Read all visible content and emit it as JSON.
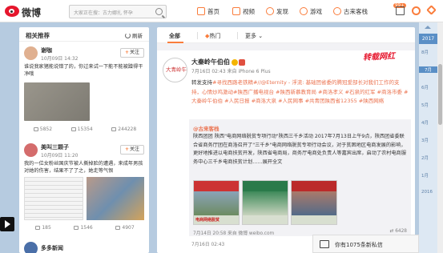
{
  "header": {
    "logo_text": "微博",
    "search_placeholder": "大家正在搜：古力娜扎 怀孕",
    "nav": [
      {
        "label": "首页",
        "icon": "home-icon"
      },
      {
        "label": "视频",
        "icon": "video-icon"
      },
      {
        "label": "发现",
        "icon": "discover-icon"
      },
      {
        "label": "游戏",
        "icon": "game-icon"
      },
      {
        "label": "古来客栈",
        "icon": "user-icon"
      }
    ],
    "badge": "99+"
  },
  "left": {
    "title": "相关推荐",
    "refresh_label": "刷新",
    "cards": [
      {
        "name": "谢咖",
        "time": "10月09日 14:32",
        "text": "谁说我家猪能说错了的，你过来试一下能不能被蹭得干净哦",
        "follow": "关注",
        "stats": [
          "5852",
          "15354",
          "244228"
        ]
      },
      {
        "name": "美叫三颗子",
        "time": "10月09日 11:20",
        "text": "我的一位女粉丝国庆节被人撕掉脸的遭遇，来成年男孩对她的伤害，结果不了了之，她走等气恨",
        "follow": "关注",
        "stats": [
          "185",
          "1546",
          "4907"
        ]
      },
      {
        "name": "多多新闻"
      }
    ]
  },
  "main": {
    "tabs": [
      {
        "label": "全部"
      },
      {
        "label": "热门"
      },
      {
        "label": "更多"
      }
    ],
    "post": {
      "avatar_text": "大青岭午伯伯",
      "name": "大秦岭午伯伯",
      "time": "7月16日 02:43 来自 iPhone 6 Plus",
      "watermark": "转载网红",
      "text_plain": "转发支持",
      "text_links": "#寻找西路老铁精#//@Eternity - 浮流: 基础团省委的腾冠爱部长对我们工作的支持，心情炒鸡激动#陕西广播电视台 #陕西新慕教育局 #商洛孝义 #石泉的红军 #商洛市委 #大秦岭午伯伯 #人民日报 #商洛大泉 #人民网事 #共青团陕西省12355 #陕西网络",
      "repost": {
        "name": "@古来客栈",
        "text": "陕西团团 陕西\"电商网络脱贫专项行动\"陕西三千乡活动 2017年7月13日上午9点，陕西团省委联合省商务厅团在商洛召开了\"三千乡\"电商网络脱贫专项行动会议，对于贫困地区电商发展的影响，更好地推进以电商扶贫开发，陕西省电商局，商务厅电商处负责人等嘉宾出席，启动了农村电商服务中心三千乡电商扶贫计划……展开全文",
        "image_caption": "电商网络脱贫",
        "footer": "7月14日 20:58 来自 微博 weibo.com",
        "stats": "6428"
      },
      "footer": "7月16日 02:43"
    }
  },
  "timeline": {
    "year": "2017",
    "months": [
      "8月",
      "7月",
      "6月",
      "5月",
      "4月",
      "3月",
      "2月",
      "1月",
      "2016"
    ]
  },
  "message": {
    "text": "你有1075条新私信"
  }
}
